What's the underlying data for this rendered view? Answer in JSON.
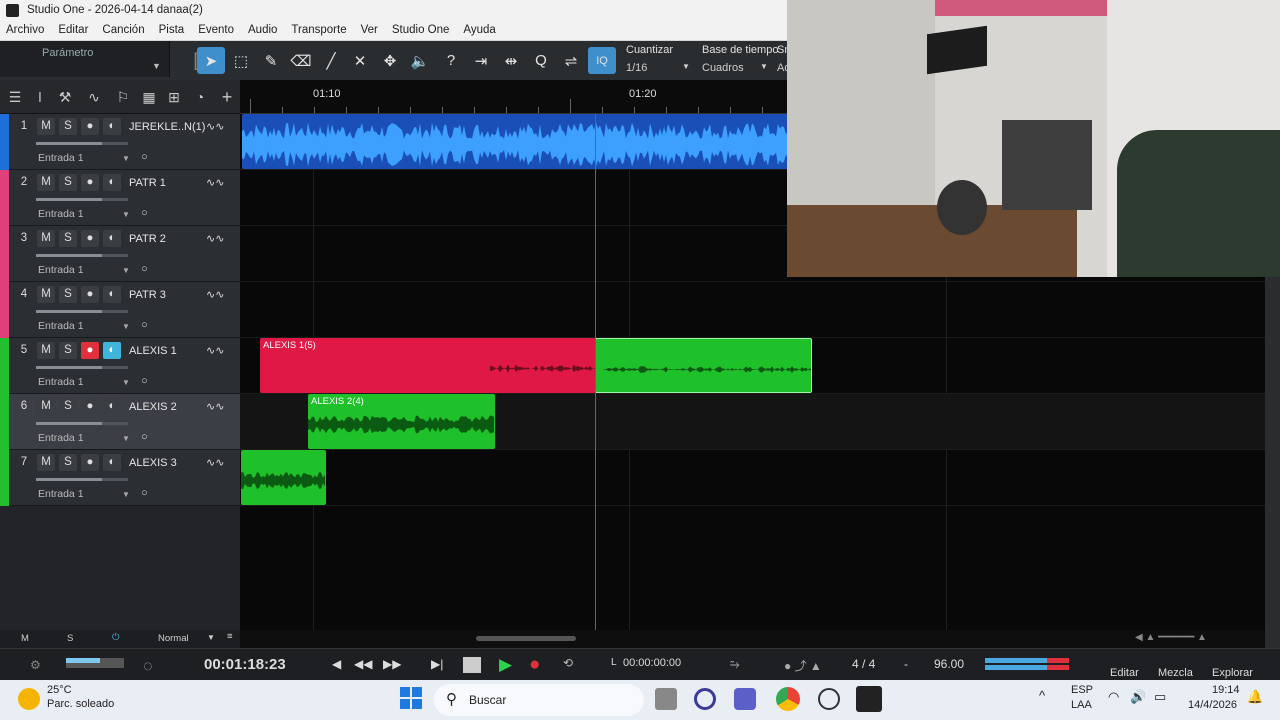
{
  "window": {
    "title": "Studio One - 2026-04-14 danaa(2)"
  },
  "menu": [
    "Archivo",
    "Editar",
    "Canción",
    "Pista",
    "Evento",
    "Audio",
    "Transporte",
    "Ver",
    "Studio One",
    "Ayuda"
  ],
  "toolbar": {
    "parameter_label": "Parámetro",
    "quantize_label": "Cuantizar",
    "quantize_value": "1/16",
    "timebase_label": "Base de tiempo",
    "timebase_value": "Cuadros",
    "snap_label": "Sn",
    "snap_value": "Ad",
    "iq_label": "IQ",
    "tools": [
      "arrow-tool-icon",
      "range-tool-icon",
      "pencil-tool-icon",
      "eraser-tool-icon",
      "paint-tool-icon",
      "mute-tool-icon",
      "split-tool-icon",
      "listen-tool-icon",
      "help-icon"
    ]
  },
  "ruler": {
    "labels": [
      "01:10",
      "01:20"
    ]
  },
  "tracks": [
    {
      "num": "1",
      "name": "JEREKLE..N(1)",
      "input": "Entrada 1",
      "color": "#1e6fd9",
      "volume": 0.72,
      "rec": false,
      "monitor": false
    },
    {
      "num": "2",
      "name": "PATR 1",
      "input": "Entrada 1",
      "color": "#e0407a",
      "volume": 0.72,
      "rec": false,
      "monitor": false
    },
    {
      "num": "3",
      "name": "PATR 2",
      "input": "Entrada 1",
      "color": "#e0407a",
      "volume": 0.72,
      "rec": false,
      "monitor": false
    },
    {
      "num": "4",
      "name": "PATR 3",
      "input": "Entrada 1",
      "color": "#e0407a",
      "volume": 0.72,
      "rec": false,
      "monitor": false
    },
    {
      "num": "5",
      "name": "ALEXIS 1",
      "input": "Entrada 1",
      "color": "#22c02e",
      "volume": 0.72,
      "rec": true,
      "monitor": true
    },
    {
      "num": "6",
      "name": "ALEXIS 2",
      "input": "Entrada 1",
      "color": "#22c02e",
      "volume": 0.72,
      "rec": false,
      "monitor": false
    },
    {
      "num": "7",
      "name": "ALEXIS 3",
      "input": "Entrada 1",
      "color": "#22c02e",
      "volume": 0.72,
      "rec": false,
      "monitor": false
    }
  ],
  "clips": [
    {
      "label": "",
      "color": "#1a4fb8"
    },
    {
      "label": "ALEXIS 1(5)",
      "color": "#e01845"
    },
    {
      "label": "",
      "color": "#1ec12a"
    },
    {
      "label": "ALEXIS 2(4)",
      "color": "#1ec12a"
    },
    {
      "label": "",
      "color": "#1ec12a"
    }
  ],
  "bottombar": {
    "m": "M",
    "s": "S",
    "mode": "Normal"
  },
  "transport": {
    "time": "00:01:18:23",
    "loop_start": "00:00:00:00",
    "l_label": "L",
    "signature": "4 / 4",
    "dash": "-",
    "tempo": "96.00",
    "tabs": [
      "Editar",
      "Mezcla",
      "Explorar"
    ]
  },
  "taskbar": {
    "temp": "25°C",
    "weather": "Parc. soleado",
    "search": "Buscar",
    "lang1": "ESP",
    "lang2": "LAA",
    "clock": "19:14",
    "date": "14/4/2026"
  }
}
